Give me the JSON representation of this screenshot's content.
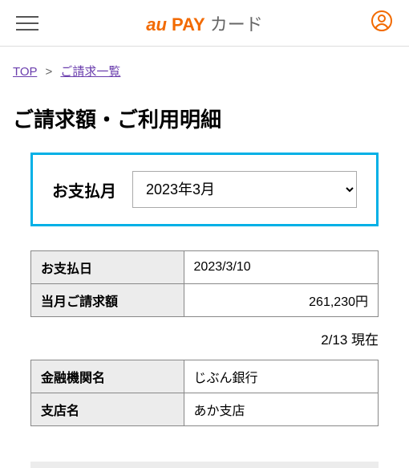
{
  "header": {
    "logo_au": "au",
    "logo_pay": "PAY",
    "logo_card": "カード"
  },
  "breadcrumb": {
    "top": "TOP",
    "sep": ">",
    "current": "ご請求一覧"
  },
  "page_title": "ご請求額・ご利用明細",
  "selector": {
    "label": "お支払月",
    "value": "2023年3月"
  },
  "table1": {
    "row1_label": "お支払日",
    "row1_value": "2023/3/10",
    "row2_label": "当月ご請求額",
    "row2_value": "261,230円"
  },
  "timestamp": "2/13 現在",
  "table2": {
    "row1_label": "金融機関名",
    "row1_value": "じぶん銀行",
    "row2_label": "支店名",
    "row2_value": "あか支店"
  }
}
